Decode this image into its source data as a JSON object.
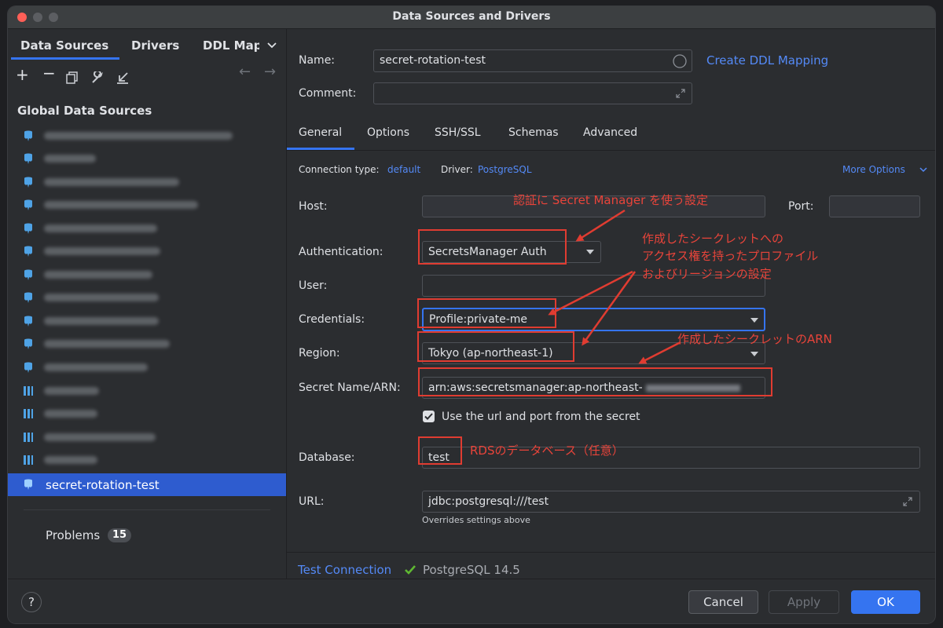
{
  "window": {
    "title": "Data Sources and Drivers"
  },
  "sidebar": {
    "tabs": [
      "Data Sources",
      "Drivers",
      "DDL Map"
    ],
    "section_title": "Global Data Sources",
    "selected_item": "secret-rotation-test",
    "problems_label": "Problems",
    "problems_count": "15"
  },
  "form": {
    "name_label": "Name:",
    "name_value": "secret-rotation-test",
    "create_ddl_link": "Create DDL Mapping",
    "comment_label": "Comment:",
    "tabs": [
      "General",
      "Options",
      "SSH/SSL",
      "Schemas",
      "Advanced"
    ],
    "connection_type_label": "Connection type:",
    "connection_type_value": "default",
    "driver_label": "Driver:",
    "driver_value": "PostgreSQL",
    "more_options": "More Options",
    "host_label": "Host:",
    "port_label": "Port:",
    "auth_label": "Authentication:",
    "auth_value": "SecretsManager Auth",
    "user_label": "User:",
    "credentials_label": "Credentials:",
    "credentials_value": "Profile:private-me",
    "region_label": "Region:",
    "region_value": "Tokyo (ap-northeast-1)",
    "secret_label": "Secret Name/ARN:",
    "secret_value": "arn:aws:secretsmanager:ap-northeast-",
    "use_url_checkbox": "Use the url and port from the secret",
    "database_label": "Database:",
    "database_value": "test",
    "url_label": "URL:",
    "url_value": "jdbc:postgresql:///test",
    "url_hint": "Overrides settings above"
  },
  "annotations": {
    "auth_note": "認証に Secret Manager を使う設定",
    "profile_note_1": "作成したシークレットへの",
    "profile_note_2": "アクセス権を持ったプロファイル",
    "profile_note_3": "およびリージョンの設定",
    "arn_note": "作成したシークレットのARN",
    "db_note": "RDSのデータベース（任意）"
  },
  "footer": {
    "test_connection": "Test Connection",
    "status": "PostgreSQL 14.5",
    "cancel": "Cancel",
    "apply": "Apply",
    "ok": "OK"
  },
  "colors": {
    "accent": "#548af7",
    "selection": "#2e5ccf",
    "annotation": "#e03c31",
    "ok_button": "#3574f0"
  }
}
